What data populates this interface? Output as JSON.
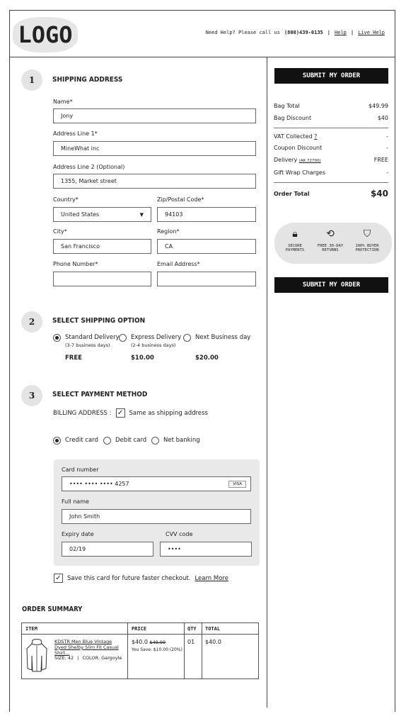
{
  "header": {
    "logo": "LOGO",
    "help_text": "Need Help? Please call us",
    "phone": "(800)439-0135",
    "sep1": "|",
    "help_link": "Help",
    "sep2": "|",
    "live_help": "Live Help"
  },
  "shipping": {
    "step": "1",
    "title": "SHIPPING ADDRESS",
    "name_label": "Name",
    "name_value": "Jony",
    "addr1_label": "Address Line 1",
    "addr1_value": "MineWhat inc",
    "addr2_label": "Address Line 2 (Optional)",
    "addr2_value": "1355, Market street",
    "country_label": "Country",
    "country_value": "United States",
    "zip_label": "Zip/Postal Code",
    "zip_value": "94103",
    "city_label": "City",
    "city_value": "San Francisco",
    "region_label": "Region",
    "region_value": "CA",
    "phone_label": "Phone Number",
    "phone_value": "",
    "email_label": "Email Address",
    "email_value": "",
    "required_mark": "*"
  },
  "shipping_option": {
    "step": "2",
    "title": "SELECT SHIPPING OPTION",
    "options": [
      {
        "label": "Standard Delivery",
        "sub": "(3-7 business days)",
        "price": "FREE",
        "selected": true
      },
      {
        "label": "Express Delivery",
        "sub": "(2-4 business days)",
        "price": "$10.00",
        "selected": false
      },
      {
        "label": "Next Business day",
        "sub": "",
        "price": "$20.00",
        "selected": false
      }
    ]
  },
  "payment": {
    "step": "3",
    "title": "SELECT PAYMENT METHOD",
    "billing_label": "BILLING ADDRESS :",
    "same_as_shipping": "Same as shipping address",
    "methods": [
      {
        "label": "Credit card",
        "selected": true
      },
      {
        "label": "Debit card",
        "selected": false
      },
      {
        "label": "Net banking",
        "selected": false
      }
    ],
    "card_number_label": "Card number",
    "card_number_value": "•••• •••• ••••  4257",
    "card_brand": "VISA",
    "full_name_label": "Full name",
    "full_name_value": "John Smith",
    "expiry_label": "Expiry date",
    "expiry_value": "02/19",
    "cvv_label": "CVV code",
    "cvv_value": "••••",
    "save_card": "Save this card for future faster checkout.",
    "learn_more": "Learn More"
  },
  "order_summary": {
    "title": "ORDER SUMMARY",
    "columns": [
      "ITEM",
      "PRICE",
      "QTY",
      "TOTAL"
    ],
    "items": [
      {
        "name": "KDSTR Men Blue Vintage Dyed Shelby Slim Fit Casual Shirt...",
        "size": "SIZE: 42",
        "color": "COLOR: Gargoyle",
        "price": "$40.0",
        "old_price": "$49.99",
        "savings": "You Save: $10.00 (20%)",
        "qty": "01",
        "total": "$40.0"
      }
    ]
  },
  "sidebar": {
    "submit_label": "SUBMIT MY ORDER",
    "bag_total_label": "Bag Total",
    "bag_total_value": "$49.99",
    "bag_discount_label": "Bag Discount",
    "bag_discount_value": "$40",
    "vat_label": "VAT Collected",
    "vat_help": "?",
    "vat_value": "-",
    "coupon_label": "Coupon Discount",
    "coupon_value": "-",
    "delivery_label": "Delivery",
    "delivery_code": "(AK 72700)",
    "delivery_value": "FREE",
    "gift_label": "Gift Wrap Charges",
    "gift_value": "-",
    "order_total_label": "Order Total",
    "order_total_value": "$40",
    "trust": [
      {
        "icon": "lock-icon",
        "line1": "SECURE",
        "line2": "PAYMENTS"
      },
      {
        "icon": "refresh-icon",
        "line1": "FREE 30-DAY",
        "line2": "RETURNS"
      },
      {
        "icon": "shield-icon",
        "line1": "100% BUYER",
        "line2": "PROTECTION"
      }
    ]
  }
}
